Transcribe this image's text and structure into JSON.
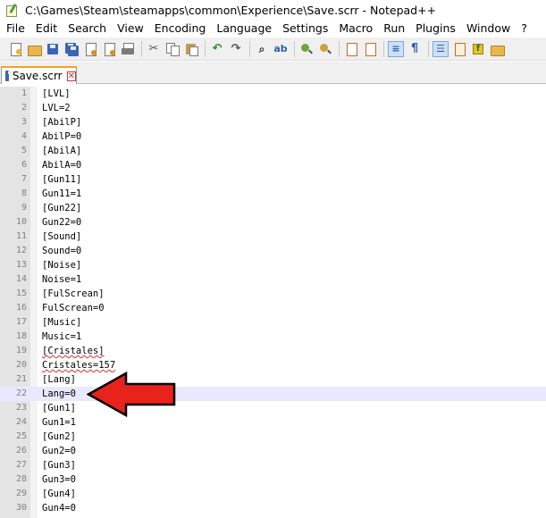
{
  "window": {
    "title": "C:\\Games\\Steam\\steamapps\\common\\Experience\\Save.scrr - Notepad++"
  },
  "menu": [
    "File",
    "Edit",
    "Search",
    "View",
    "Encoding",
    "Language",
    "Settings",
    "Macro",
    "Run",
    "Plugins",
    "Window",
    "?"
  ],
  "toolbar": {
    "icons": [
      "new-file-icon",
      "open-folder-icon",
      "save-icon",
      "save-all-icon",
      "close-icon",
      "close-all-icon",
      "print-icon",
      "cut-icon",
      "copy-icon",
      "paste-icon",
      "undo-icon",
      "redo-icon",
      "find-icon",
      "replace-icon",
      "zoom-in-icon",
      "zoom-out-icon",
      "sync-vertical-icon",
      "sync-horizontal-icon",
      "word-wrap-icon",
      "show-all-chars-icon",
      "indent-guide-icon",
      "doc-map-icon",
      "function-list-icon",
      "folder-as-workspace-icon"
    ]
  },
  "tab": {
    "label": "Save.scrr",
    "close_glyph": "✕"
  },
  "editor": {
    "current_line": 22,
    "lines": [
      {
        "num": "1",
        "text": "[LVL]"
      },
      {
        "num": "2",
        "text": "LVL=2"
      },
      {
        "num": "3",
        "text": "[AbilP]"
      },
      {
        "num": "4",
        "text": "AbilP=0"
      },
      {
        "num": "5",
        "text": "[AbilA]"
      },
      {
        "num": "6",
        "text": "AbilA=0"
      },
      {
        "num": "7",
        "text": "[Gun11]"
      },
      {
        "num": "8",
        "text": "Gun11=1"
      },
      {
        "num": "9",
        "text": "[Gun22]"
      },
      {
        "num": "10",
        "text": "Gun22=0"
      },
      {
        "num": "11",
        "text": "[Sound]"
      },
      {
        "num": "12",
        "text": "Sound=0"
      },
      {
        "num": "13",
        "text": "[Noise]"
      },
      {
        "num": "14",
        "text": "Noise=1"
      },
      {
        "num": "15",
        "text": "[FulScrean]"
      },
      {
        "num": "16",
        "text": "FulScrean=0"
      },
      {
        "num": "17",
        "text": "[Music]"
      },
      {
        "num": "18",
        "text": "Music=1"
      },
      {
        "num": "19",
        "text": "[Cristales]"
      },
      {
        "num": "20",
        "text": "Cristales=157"
      },
      {
        "num": "21",
        "text": "[Lang]"
      },
      {
        "num": "22",
        "text": "Lang=0"
      },
      {
        "num": "23",
        "text": "[Gun1]"
      },
      {
        "num": "24",
        "text": "Gun1=1"
      },
      {
        "num": "25",
        "text": "[Gun2]"
      },
      {
        "num": "26",
        "text": "Gun2=0"
      },
      {
        "num": "27",
        "text": "[Gun3]"
      },
      {
        "num": "28",
        "text": "Gun3=0"
      },
      {
        "num": "29",
        "text": "[Gun4]"
      },
      {
        "num": "30",
        "text": "Gun4=0"
      }
    ]
  },
  "annotation": {
    "arrow_color": "#e8231c",
    "points_to_line": 22
  },
  "colors": {
    "tab_accent": "#f5a223",
    "current_line_bg": "#e8e8ff",
    "gutter_bg": "#e4e4e4",
    "spellcheck_underline": "#e03030"
  }
}
